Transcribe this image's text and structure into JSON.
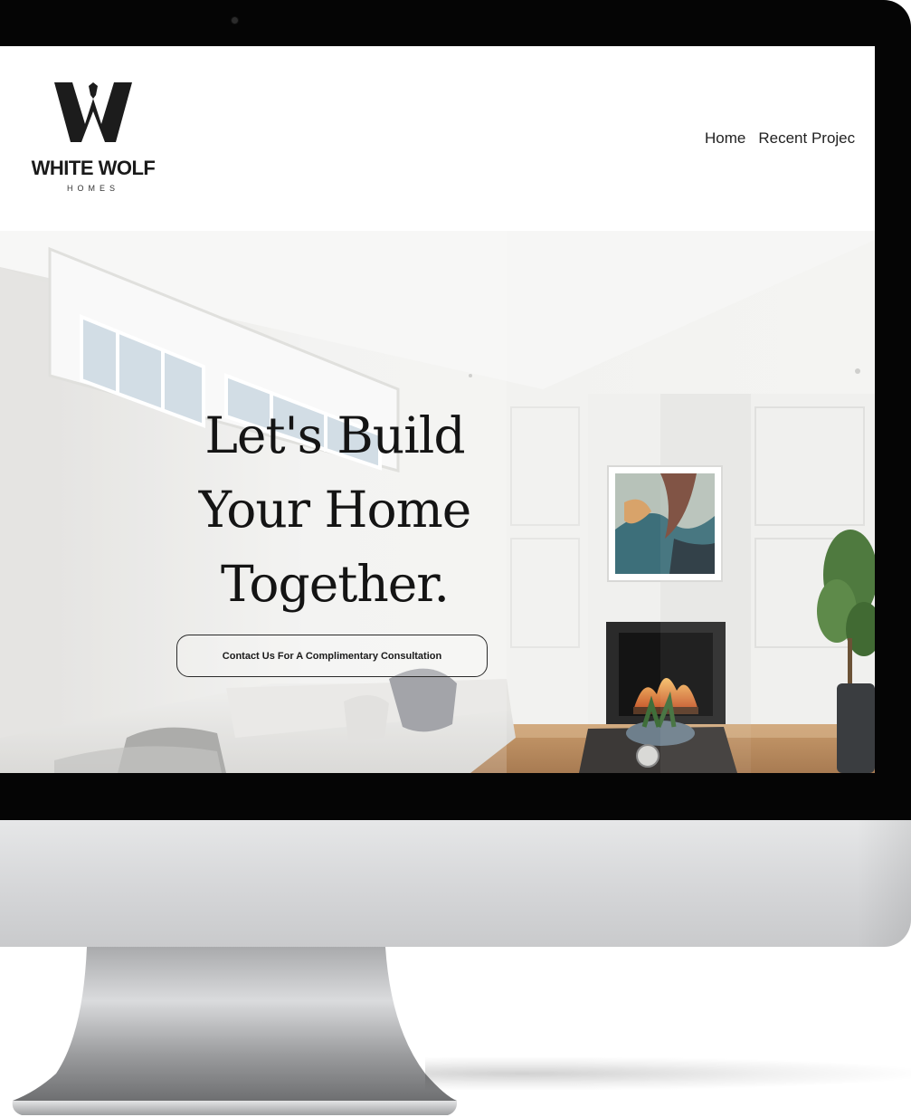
{
  "header": {
    "logo_name": "WHITE WOLF",
    "logo_sub": "HOMES",
    "nav": [
      {
        "label": "Home"
      },
      {
        "label": "Recent Projec"
      }
    ]
  },
  "hero": {
    "title_line_1": "Let's Build",
    "title_line_2": "Your Home",
    "title_line_3": "Together.",
    "cta_label": "Contact Us For A Complimentary Consultation"
  },
  "colors": {
    "bezel": "#050505",
    "chin": "#d5d6d8",
    "text_dark": "#141414",
    "hero_wall": "#f3f3f1"
  }
}
